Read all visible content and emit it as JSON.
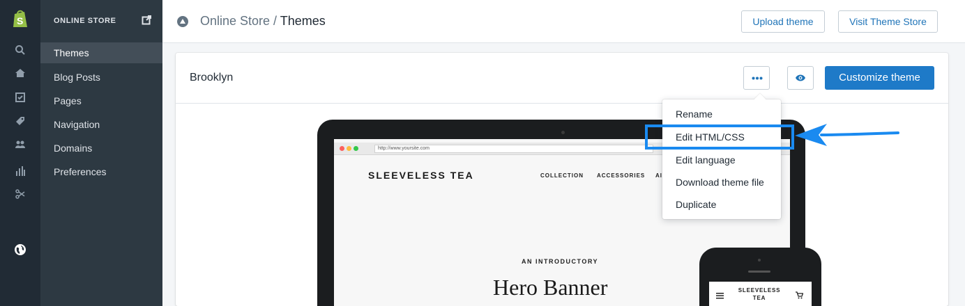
{
  "nav": {
    "store_label": "ONLINE STORE",
    "items": [
      {
        "label": "Themes"
      },
      {
        "label": "Blog Posts"
      },
      {
        "label": "Pages"
      },
      {
        "label": "Navigation"
      },
      {
        "label": "Domains"
      },
      {
        "label": "Preferences"
      }
    ]
  },
  "rail_icons": [
    "search-icon",
    "home-icon",
    "orders-icon",
    "tag-icon",
    "customers-icon",
    "reports-icon",
    "discounts-icon",
    "globe-icon"
  ],
  "topbar": {
    "breadcrumb_parent": "Online Store /",
    "breadcrumb_current": "Themes",
    "upload_label": "Upload theme",
    "visit_label": "Visit Theme Store"
  },
  "theme": {
    "name": "Brooklyn",
    "customize_label": "Customize theme"
  },
  "dropdown": {
    "items": [
      {
        "label": "Rename"
      },
      {
        "label": "Edit HTML/CSS"
      },
      {
        "label": "Edit language"
      },
      {
        "label": "Download theme file"
      },
      {
        "label": "Duplicate"
      }
    ]
  },
  "preview": {
    "url": "http://www.yoursite.com",
    "site_title": "SLEEVELESS TEA",
    "site_nav": [
      "COLLECTION",
      "ACCESSORIES",
      "AI"
    ],
    "intro": "AN INTRODUCTORY",
    "hero": "Hero Banner",
    "phone_title": "SLEEVELESS TEA"
  },
  "colors": {
    "accent": "#1e7ac8",
    "highlight": "#1a8af0",
    "sidebar_dark": "#212b35",
    "sidebar_panel": "#2d3942"
  }
}
